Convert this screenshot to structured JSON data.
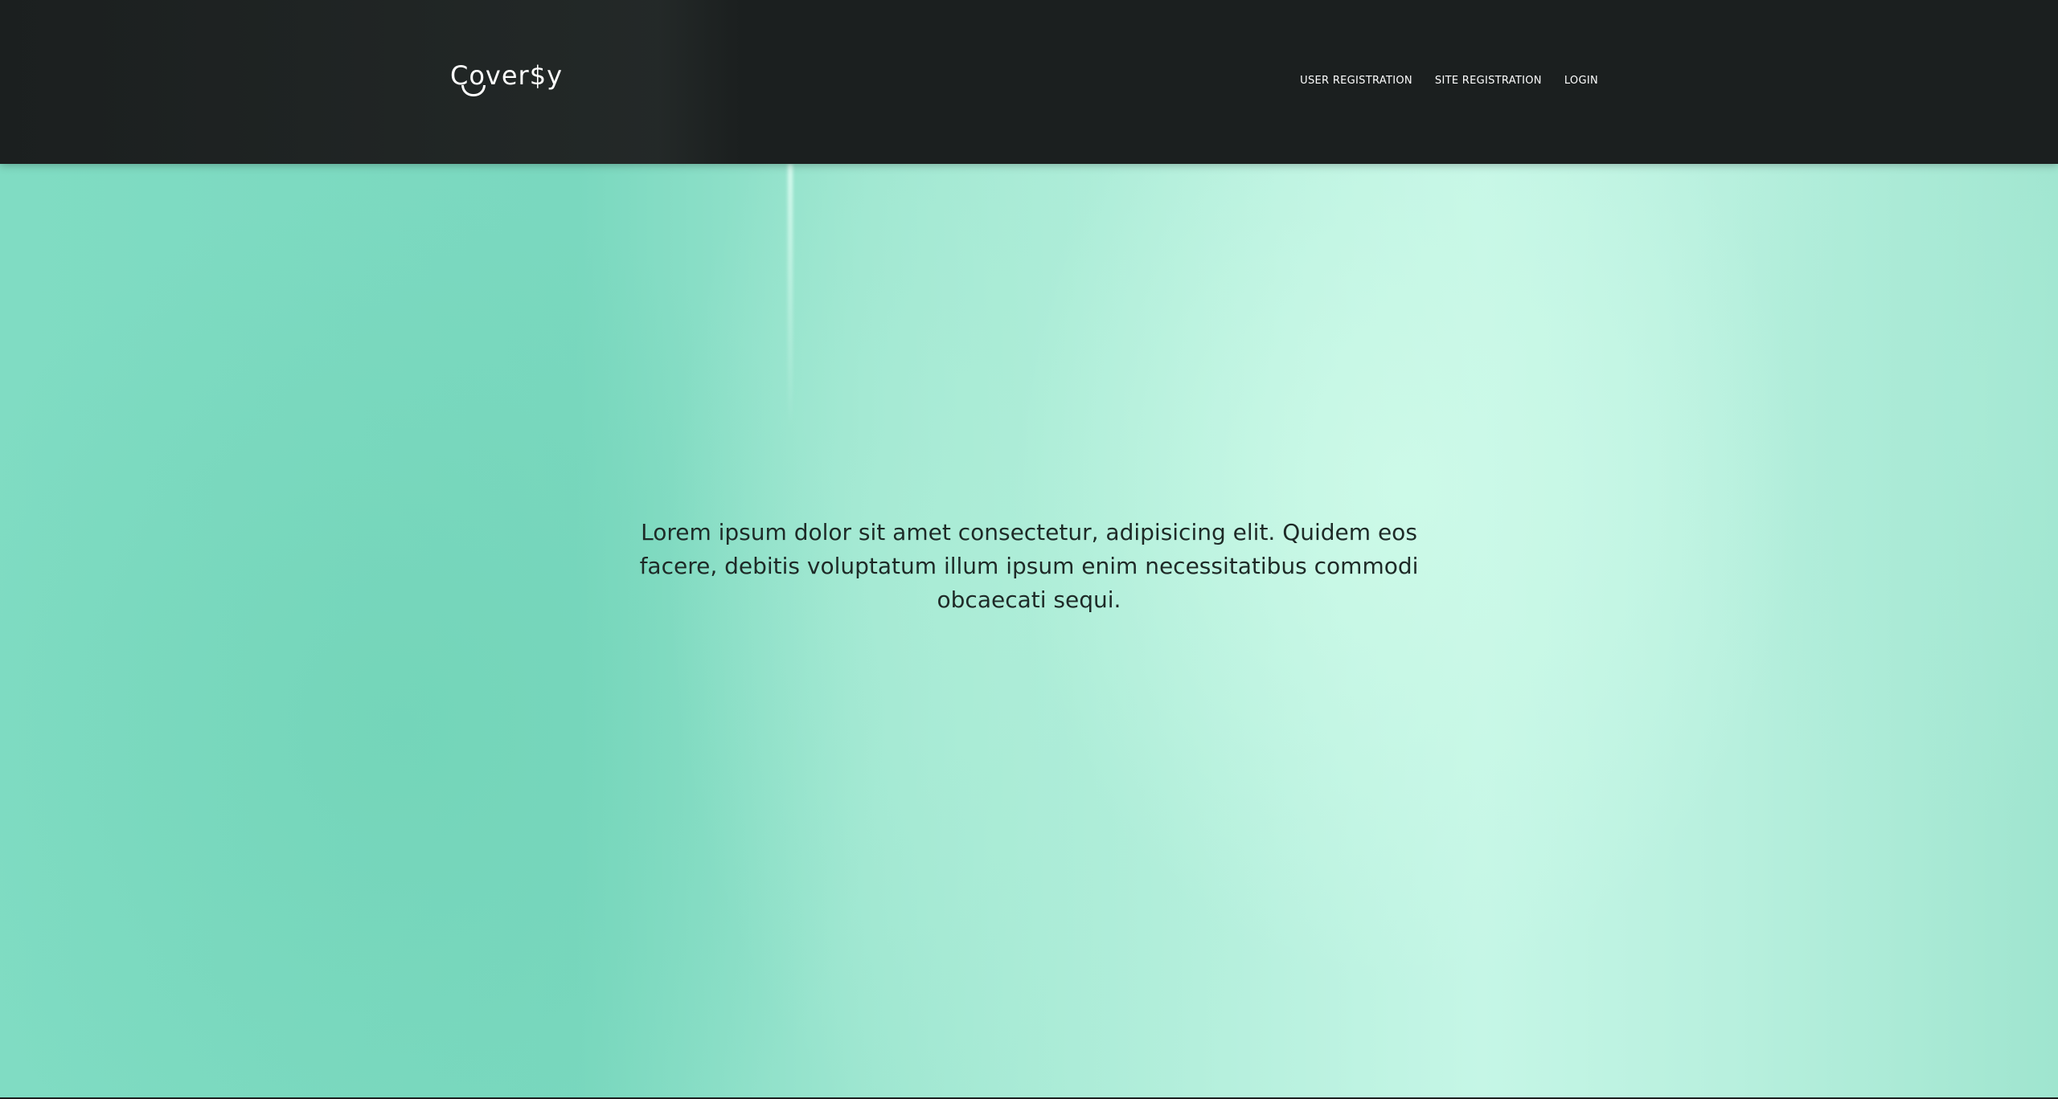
{
  "header": {
    "logo_text": "Cover$y",
    "nav": [
      {
        "label": "USER REGISTRATION"
      },
      {
        "label": "SITE REGISTRATION"
      },
      {
        "label": "LOGIN"
      }
    ]
  },
  "hero": {
    "text": "Lorem ipsum dolor sit amet consectetur, adipisicing elit. Quidem eos facere, debitis voluptatum illum ipsum enim necessitatibus commodi obcaecati sequi."
  },
  "colors": {
    "header_bg": "#1b1f1f",
    "hero_mint": "#7fdcc2",
    "hero_light_mint": "#c5f6e6",
    "text_dark": "#1e2a27",
    "nav_text": "#ffffff"
  },
  "icons": {
    "logo": "smile-logo-icon"
  }
}
